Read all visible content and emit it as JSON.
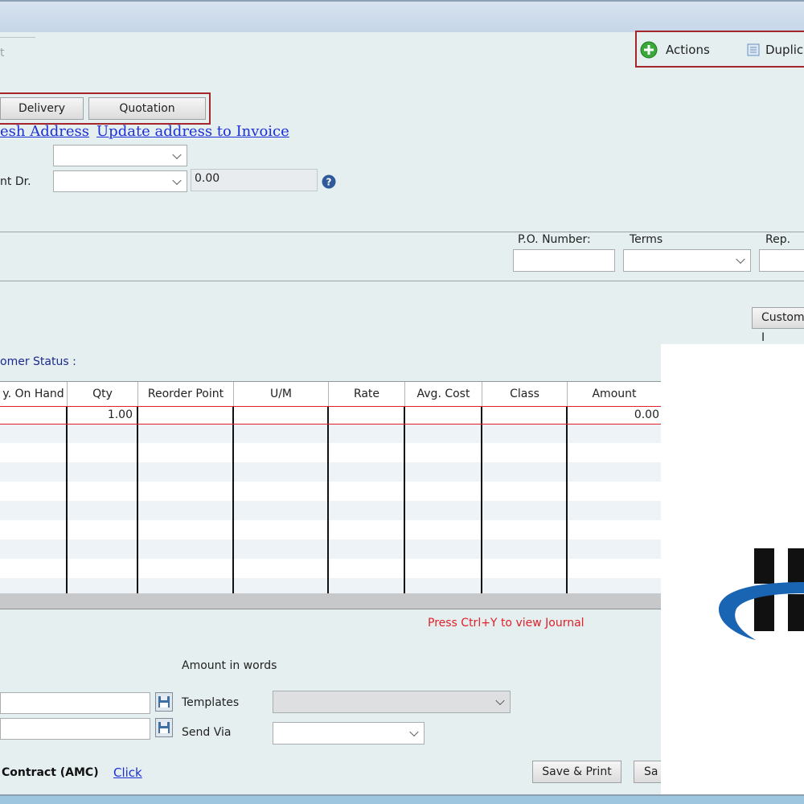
{
  "header": {
    "actions_label": "Actions",
    "duplicate_label": "Duplica",
    "faint_text": "t"
  },
  "tabs": [
    {
      "label": "Delivery"
    },
    {
      "label": "Quotation"
    }
  ],
  "links": {
    "refresh_address": "esh Address",
    "update_address": "Update address to Invoice"
  },
  "fields": {
    "account_label": "nt Dr.",
    "amount_value": "0.00",
    "po_label": "P.O. Number:",
    "terms_label": "Terms",
    "rep_label": "Rep.",
    "custom_button": "Custom I",
    "customer_status": "omer Status :"
  },
  "grid": {
    "columns": [
      "y. On Hand",
      "Qty",
      "Reorder Point",
      "U/M",
      "Rate",
      "Avg. Cost",
      "Class",
      "Amount"
    ],
    "row1": {
      "qty": "1.00",
      "amount": "0.00"
    }
  },
  "footer": {
    "journal_hint": "Press Ctrl+Y to view Journal",
    "amount_in_words": "Amount in words",
    "templates_label": "Templates",
    "send_via_label": "Send Via",
    "amc_label": "Contract (AMC)",
    "click_link": "Click",
    "save_print": "Save & Print",
    "save_partial": "Sa"
  },
  "colors": {
    "background": "#e5eff0",
    "highlight_border": "#a3262a",
    "link": "#1d2fd6",
    "journal_hint": "#e0202a",
    "status_text": "#1b2a8f",
    "logo_blue": "#1a64b4"
  },
  "icons": {
    "actions": "plus-circle-icon",
    "duplicate": "document-icon",
    "help": "question-icon",
    "save": "floppy-icon"
  }
}
